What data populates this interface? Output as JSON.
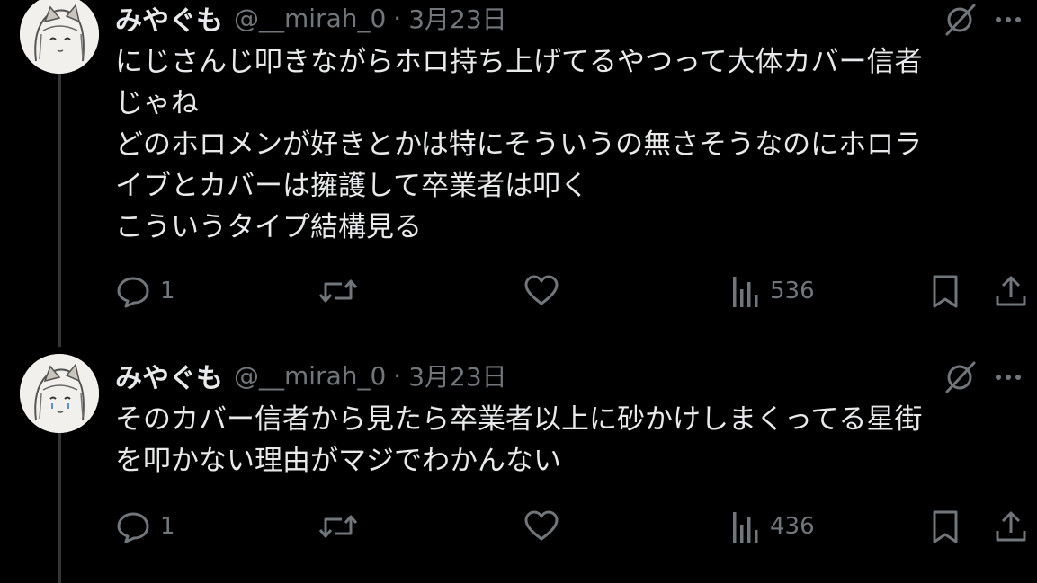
{
  "tweets": [
    {
      "display_name": "みやぐも",
      "handle": "@__mirah_0",
      "separator": "·",
      "date": "3月23日",
      "text": "にじさんじ叩きながらホロ持ち上げてるやつって大体カバー信者\nじゃね\nどのホロメンが好きとかは特にそういうの無さそうなのにホロラ\nイブとカバーは擁護して卒業者は叩く\nこういうタイプ結構見る",
      "replies": "1",
      "retweets": "",
      "likes": "",
      "views": "536"
    },
    {
      "display_name": "みやぐも",
      "handle": "@__mirah_0",
      "separator": "·",
      "date": "3月23日",
      "text": "そのカバー信者から見たら卒業者以上に砂かけしまくってる星街\nを叩かない理由がマジでわかんない",
      "replies": "1",
      "retweets": "",
      "likes": "",
      "views": "436"
    }
  ],
  "icons": {
    "reply": "reply-icon",
    "retweet": "retweet-icon",
    "like": "heart-icon",
    "views": "views-icon",
    "bookmark": "bookmark-icon",
    "share": "share-icon",
    "grok": "grok-icon",
    "more": "more-icon"
  },
  "colors": {
    "background": "#000000",
    "text": "#e7e9ea",
    "muted": "#71767b",
    "thread_line": "#333639"
  }
}
